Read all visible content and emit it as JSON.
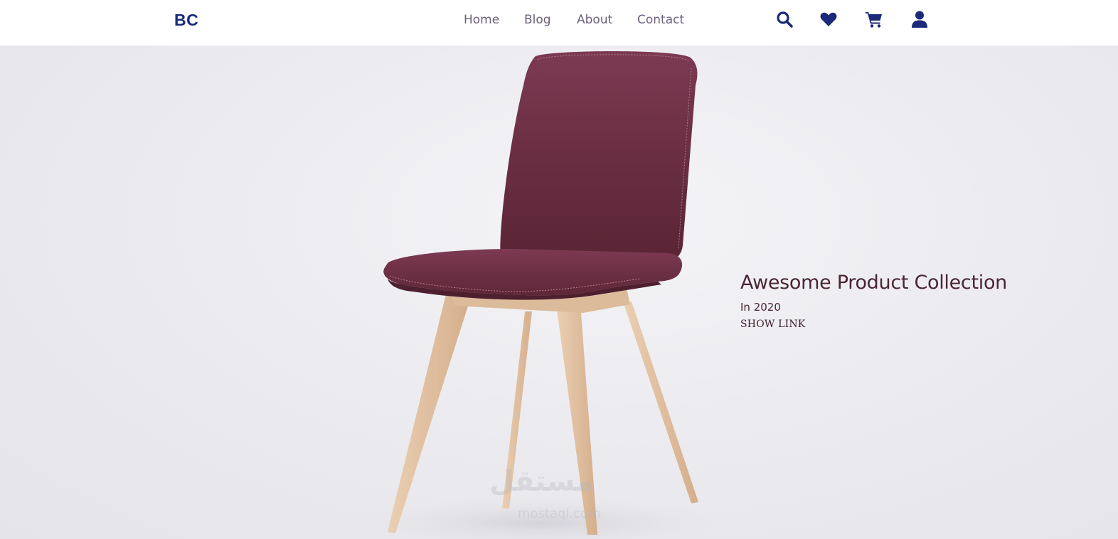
{
  "brand": {
    "logo": "BC"
  },
  "nav": {
    "links": [
      {
        "label": "Home"
      },
      {
        "label": "Blog"
      },
      {
        "label": "About"
      },
      {
        "label": "Contact"
      }
    ],
    "icons": [
      "search-icon",
      "heart-icon",
      "cart-icon",
      "user-icon"
    ]
  },
  "hero": {
    "title": "Awesome Product Collection",
    "subtitle": "In 2020",
    "link_label": "SHOW LINK"
  },
  "colors": {
    "brand": "#1a2a78",
    "nav_link": "#6f5f7c",
    "hero_text": "#4a2633",
    "chair_upholstery": "#6e2f45",
    "chair_wood": "#e0bfa0",
    "background": "#ececf0"
  }
}
